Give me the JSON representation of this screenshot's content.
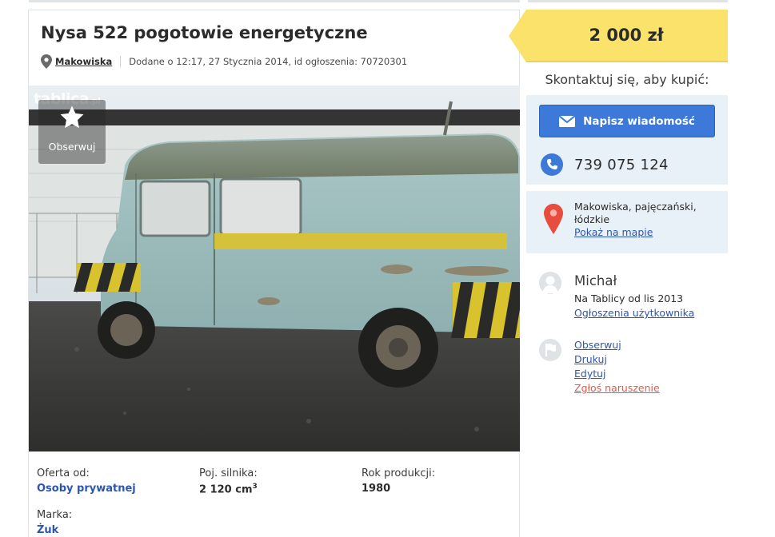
{
  "listing": {
    "title": "Nysa 522 pogotowie energetyczne",
    "location": "Makowiska",
    "added": "Dodane o 12:17, 27 Stycznia 2014, id ogłoszenia: 70720301"
  },
  "photo": {
    "watermark": "tablica",
    "watermark_suffix": ".pl",
    "observe_label": "Obserwuj"
  },
  "details": {
    "offer_from_label": "Oferta od:",
    "offer_from_value": "Osoby prywatnej",
    "engine_label": "Poj. silnika:",
    "engine_value": "2 120 cm",
    "engine_unit_sup": "3",
    "year_label": "Rok produkcji:",
    "year_value": "1980",
    "brand_label": "Marka:",
    "brand_value": "Żuk"
  },
  "sidebar": {
    "price": "2 000 zł",
    "contact_heading": "Skontaktuj się, aby kupić:",
    "message_button": "Napisz wiadomość",
    "phone": "739 075 124",
    "address_line1": "Makowiska, pajęczański,",
    "address_line2": "łódzkie",
    "show_on_map": "Pokaż na mapie",
    "user_name": "Michał",
    "user_since": "Na Tablicy od lis 2013",
    "user_ads": "Ogłoszenia użytkownika",
    "action_observe": "Obserwuj",
    "action_print": "Drukuj",
    "action_edit": "Edytuj",
    "action_report": "Zgłoś naruszenie"
  },
  "colors": {
    "price_tag": "#fbe26a",
    "button_blue": "#3c79d8",
    "link_blue": "#2d56b2",
    "panel_bg": "#e9f1f8",
    "report_red": "#e05a4e",
    "map_pin_red": "#e84c3d"
  },
  "icons": {
    "location": "map-pin-icon",
    "observe": "star-icon",
    "message": "envelope-icon",
    "phone": "phone-icon",
    "map": "map-marker-icon",
    "user": "user-avatar-icon",
    "actions": "flag-icon"
  }
}
